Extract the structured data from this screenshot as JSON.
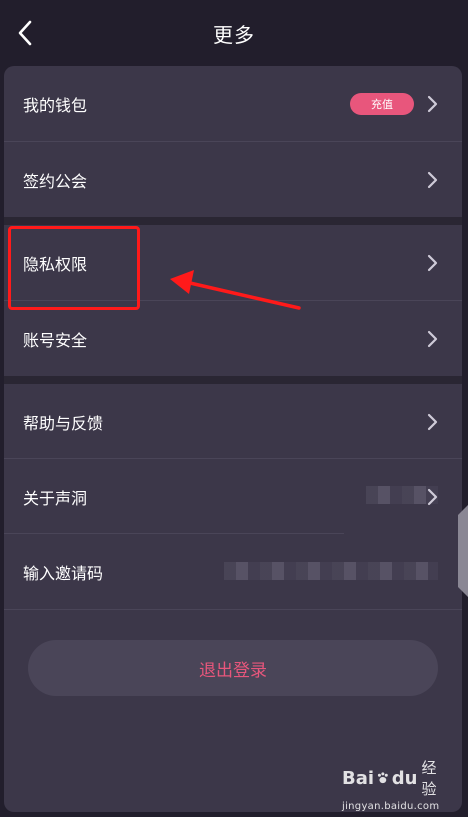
{
  "header": {
    "title": "更多"
  },
  "menu": {
    "wallet": {
      "label": "我的钱包",
      "badge": "充值"
    },
    "guild": {
      "label": "签约公会"
    },
    "privacy": {
      "label": "隐私权限"
    },
    "security": {
      "label": "账号安全"
    },
    "help": {
      "label": "帮助与反馈"
    },
    "about": {
      "label": "关于声洞"
    },
    "invite": {
      "label": "输入邀请码"
    }
  },
  "logout": {
    "label": "退出登录"
  },
  "watermark": {
    "brand_a": "Bai",
    "brand_b": "du",
    "brand_c": "经验",
    "url": "jingyan.baidu.com"
  },
  "colors": {
    "accent": "#e8567c",
    "annotation": "#ff1a1a",
    "card": "#3c3749",
    "background": "#221e2c"
  },
  "icons": {
    "back": "chevron-left-icon",
    "row_arrow": "chevron-right-icon"
  }
}
